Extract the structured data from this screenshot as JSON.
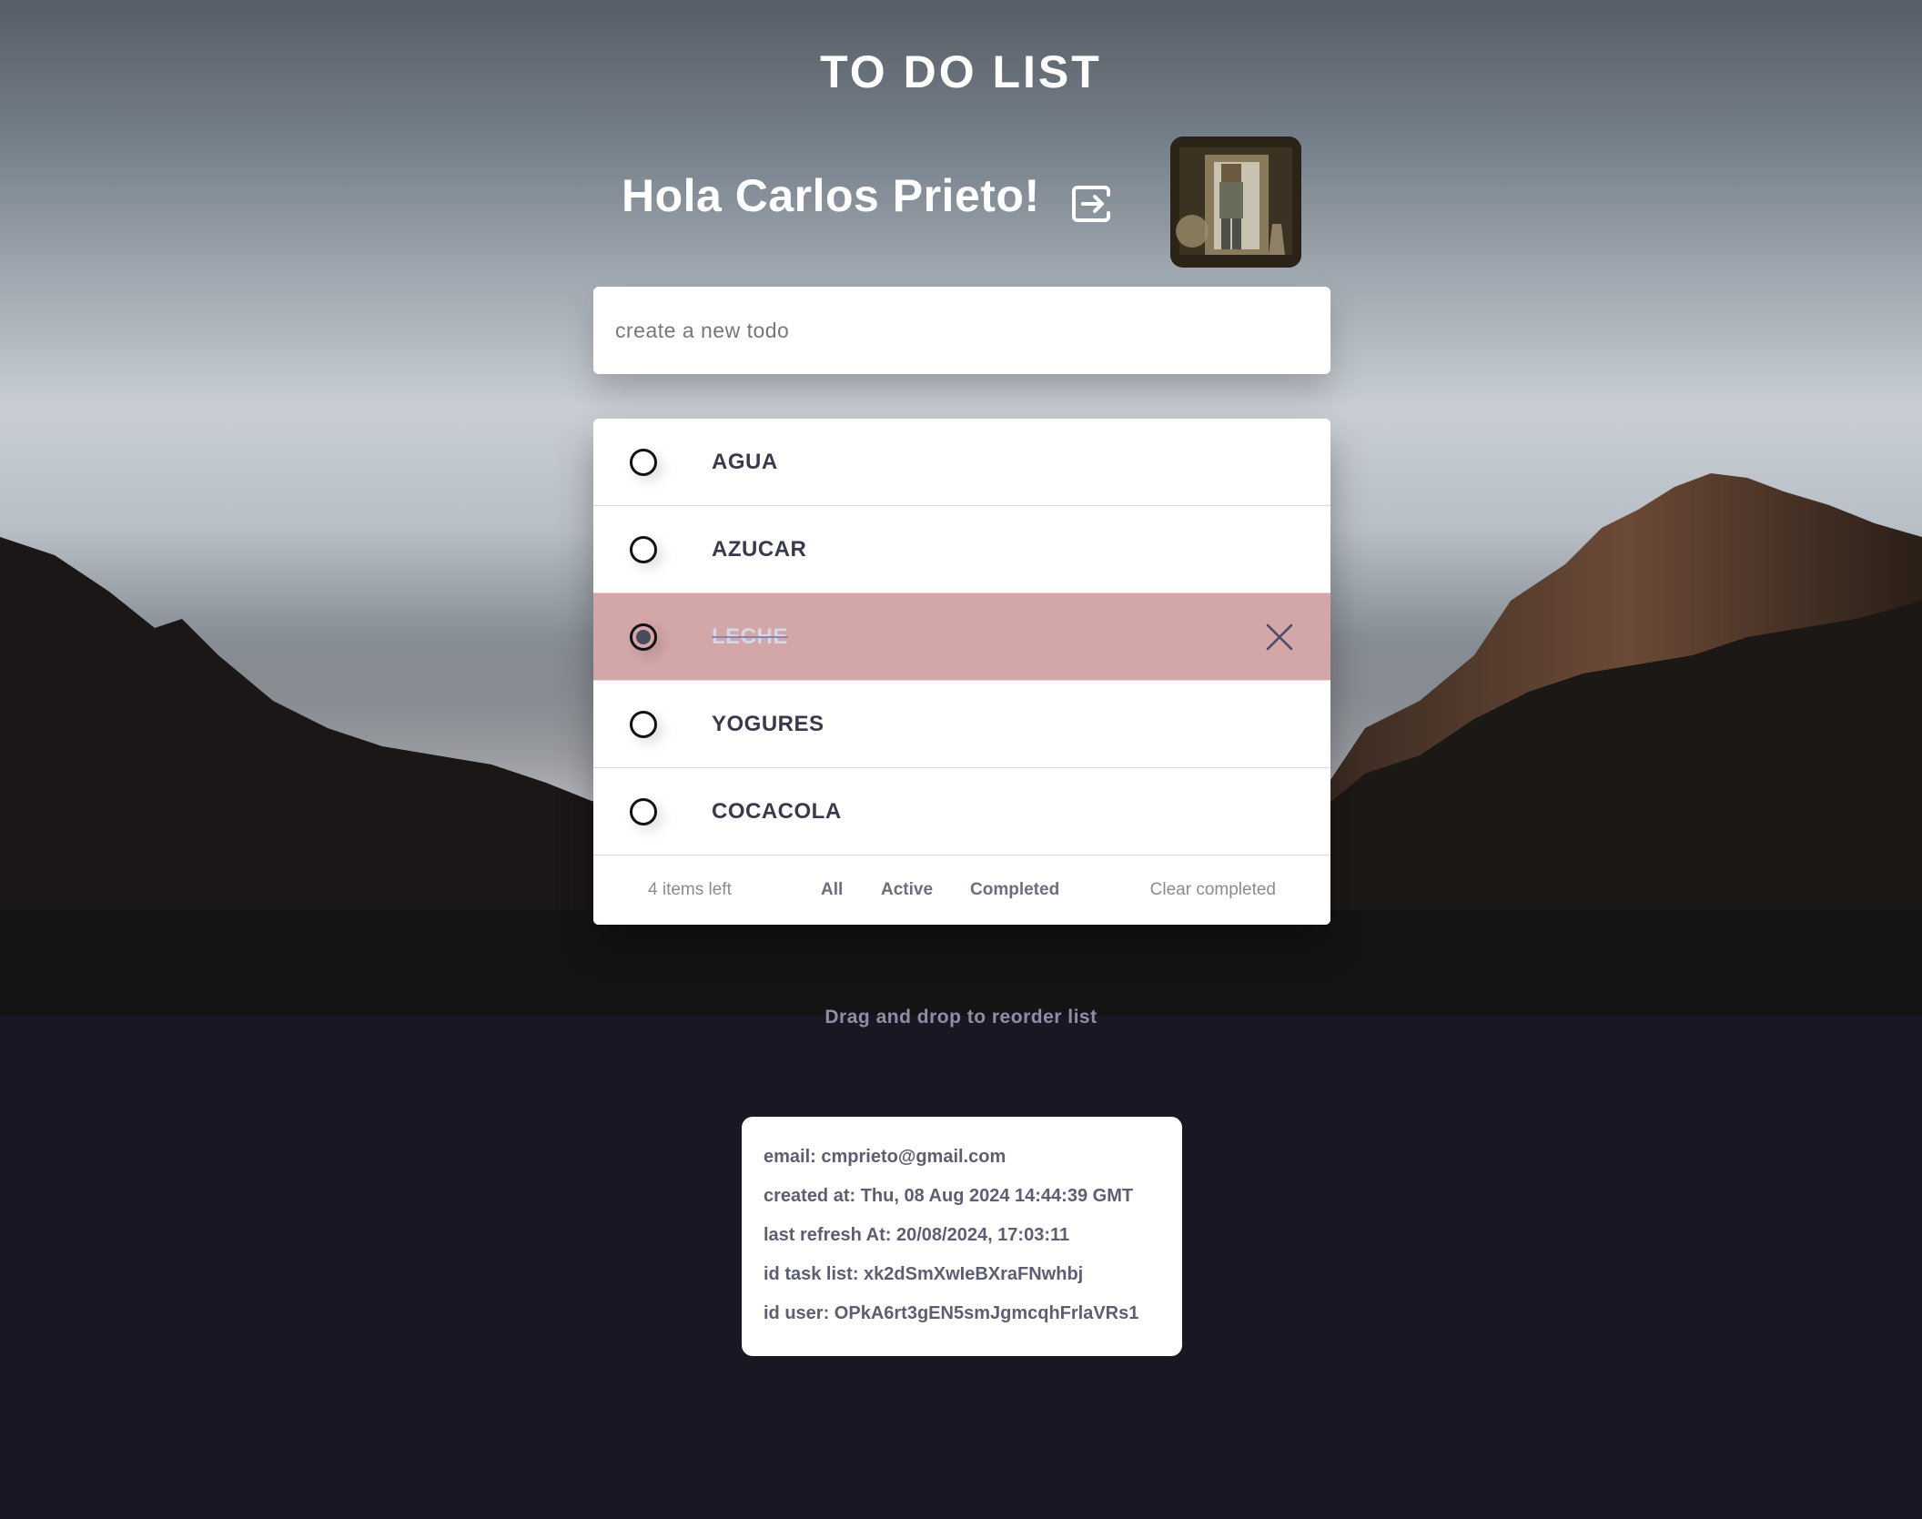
{
  "app": {
    "title": "TO DO LIST",
    "greeting": "Hola Carlos Prieto!"
  },
  "icons": {
    "logout": "logout-icon",
    "delete": "close-icon",
    "check": "radio-check-icon"
  },
  "new_todo": {
    "placeholder": "create a new todo",
    "value": ""
  },
  "todos": [
    {
      "label": "AGUA",
      "completed": false
    },
    {
      "label": "AZUCAR",
      "completed": false
    },
    {
      "label": "LECHE",
      "completed": true
    },
    {
      "label": "YOGURES",
      "completed": false
    },
    {
      "label": "COCACOLA",
      "completed": false
    }
  ],
  "footer": {
    "items_left": "4 items left",
    "filter_all": "All",
    "filter_active": "Active",
    "filter_completed": "Completed",
    "clear_completed": "Clear completed"
  },
  "hint": "Drag and drop to reorder list",
  "info": {
    "email": "email: cmprieto@gmail.com",
    "created_at": "created at: Thu, 08 Aug 2024 14:44:39 GMT",
    "last_refresh": "last refresh At: 20/08/2024, 17:03:11",
    "id_task_list": "id task list: xk2dSmXwIeBXraFNwhbj",
    "id_user": "id user: OPkA6rt3gEN5smJgmcqhFrlaVRs1"
  },
  "colors": {
    "completed_row": "#d3a6a8",
    "page_bg": "#181824",
    "card_text": "#5d5e72"
  }
}
